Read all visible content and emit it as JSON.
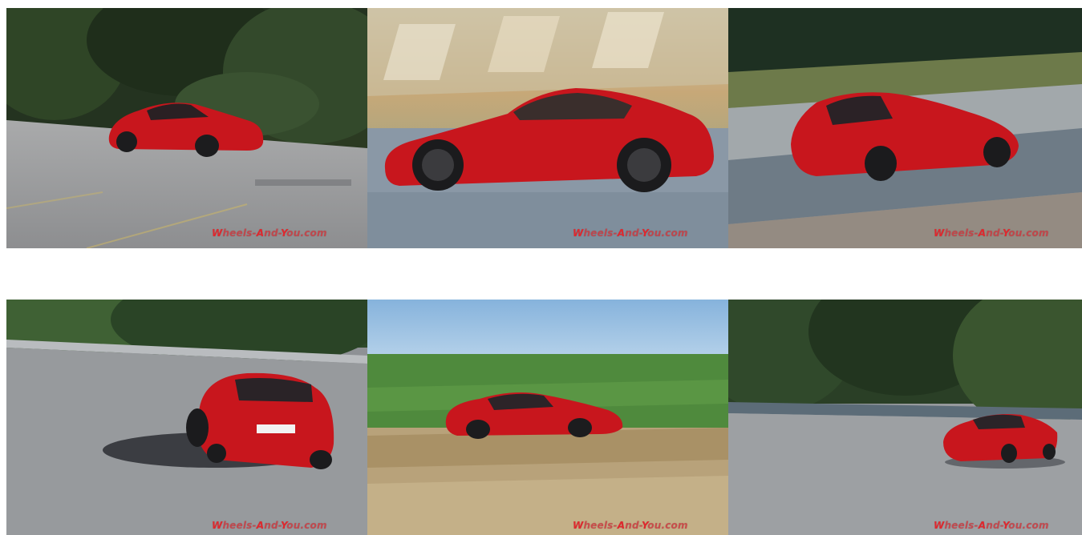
{
  "gallery": {
    "watermark": {
      "segments": [
        {
          "text": "W",
          "accent": true
        },
        {
          "text": "heels-",
          "accent": false
        },
        {
          "text": "A",
          "accent": true
        },
        {
          "text": "nd-",
          "accent": false
        },
        {
          "text": "Y",
          "accent": true
        },
        {
          "text": "ou.com",
          "accent": false
        }
      ]
    },
    "photos": [
      {
        "scene": "red sports car on asphalt lot, trees behind"
      },
      {
        "scene": "red sports car side profile, motion blur"
      },
      {
        "scene": "red sports car rear three-quarter on road"
      },
      {
        "scene": "red sports car rear view on asphalt"
      },
      {
        "scene": "red sports car in green field, blue sky"
      },
      {
        "scene": "red sports car on lot in front of trees"
      }
    ]
  },
  "colors": {
    "car_red": "#c8161d",
    "watermark_red": "#e0282e"
  }
}
